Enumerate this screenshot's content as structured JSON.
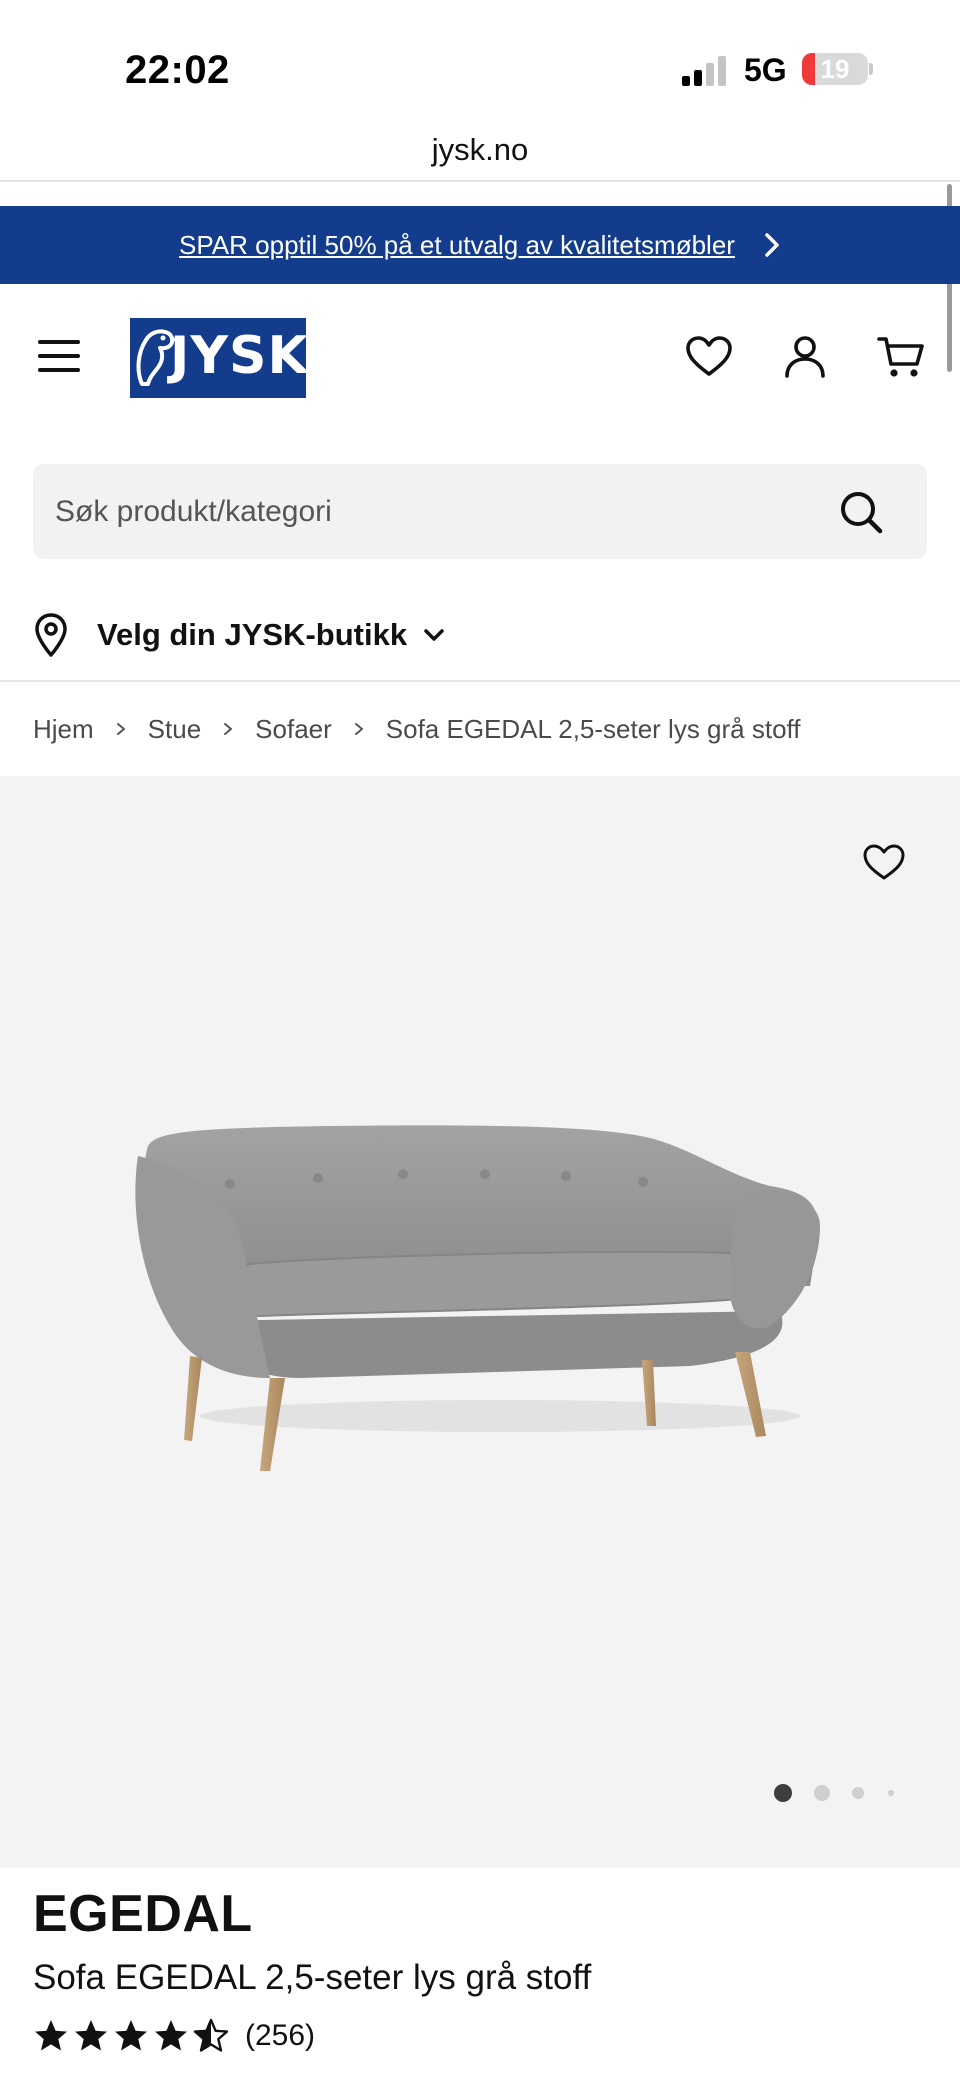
{
  "status_bar": {
    "time": "22:02",
    "network": "5G",
    "battery_level": "19",
    "battery_fraction": 0.19
  },
  "browser": {
    "url": "jysk.no"
  },
  "promo_banner": {
    "text": "SPAR opptil 50% på et utvalg av kvalitetsmøbler",
    "background_color": "#143c8c",
    "icon": "chevron-right-icon"
  },
  "header": {
    "logo_text": "JYSK",
    "brand_color": "#143c8c",
    "icons": [
      "menu-icon",
      "heart-icon",
      "user-icon",
      "cart-icon"
    ]
  },
  "search": {
    "placeholder": "Søk produkt/kategori",
    "value": ""
  },
  "store_selector": {
    "label": "Velg din JYSK-butikk",
    "icon": "location-pin-icon"
  },
  "breadcrumb": [
    "Hjem",
    "Stue",
    "Sofaer",
    "Sofa EGEDAL 2,5-seter lys grå stoff"
  ],
  "gallery": {
    "image_count": 4,
    "active_index": 0
  },
  "product": {
    "brand": "EGEDAL",
    "name": "Sofa EGEDAL 2,5-seter lys grå stoff",
    "rating": 4.5,
    "rating_max": 5,
    "review_count": "(256)"
  }
}
